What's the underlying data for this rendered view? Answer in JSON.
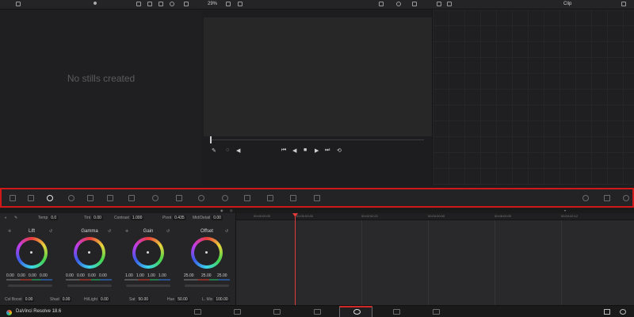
{
  "top_bar": {
    "zoom": "29%",
    "clip_mode": "Clip"
  },
  "gallery": {
    "empty_message": "No stills created"
  },
  "primaries": {
    "temp_label": "Temp",
    "temp_value": "0.0",
    "tint_label": "Tint",
    "tint_value": "0.00",
    "contrast_label": "Contrast",
    "contrast_value": "1.000",
    "pivot_label": "Pivot",
    "pivot_value": "0.435",
    "middetail_label": "Mid/Detail",
    "middetail_value": "0.00",
    "wheels": [
      {
        "name": "Lift",
        "values": [
          "0.00",
          "0.00",
          "0.00",
          "0.00"
        ]
      },
      {
        "name": "Gamma",
        "values": [
          "0.00",
          "0.00",
          "0.00",
          "0.00"
        ]
      },
      {
        "name": "Gain",
        "values": [
          "1.00",
          "1.00",
          "1.00",
          "1.00"
        ]
      },
      {
        "name": "Offset",
        "values": [
          "25.00",
          "25.00",
          "25.00"
        ]
      }
    ],
    "colboost_label": "Col Boost",
    "colboost_value": "0.00",
    "shad_label": "Shad",
    "shad_value": "0.00",
    "hilight_label": "Hi/Light",
    "hilight_value": "0.00",
    "sat_label": "Sat",
    "sat_value": "50.00",
    "hue_label": "Hue",
    "hue_value": "50.00",
    "lmix_label": "L. Mix",
    "lmix_value": "100.00"
  },
  "timeline": {
    "timecodes": [
      "00:00:00:00",
      "01:00:00:00",
      "00:02:52:21",
      "00:04:00:00",
      "00:08:00:00",
      "00:04:42:12"
    ]
  },
  "footer": {
    "app_name": "DaVinci Resolve 18.6"
  }
}
